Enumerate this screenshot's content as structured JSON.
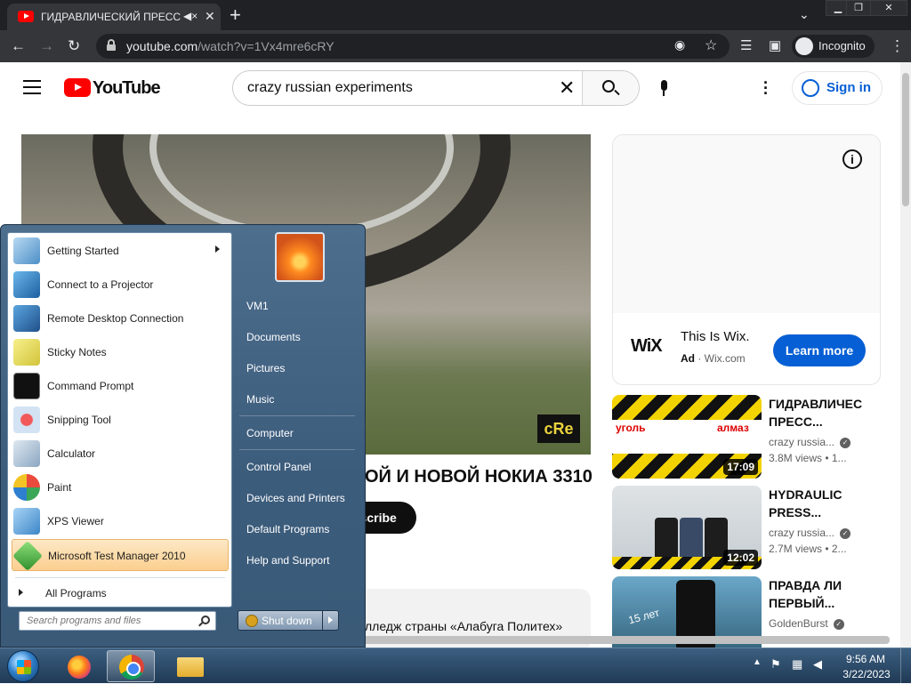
{
  "browser": {
    "tab_title": "ГИДРАВЛИЧЕСКИЙ ПРЕСС",
    "url_host": "youtube.com",
    "url_path": "/watch?v=1Vx4mre6cRY",
    "incognito_label": "Incognito"
  },
  "youtube": {
    "logo_text": "YouTube",
    "search_value": "crazy russian experiments",
    "signin_label": "Sign in",
    "video_title": "ОЙ И НОВОЙ НОКИА 3310",
    "subscribe_label": "bscribe",
    "watermark": "cRe",
    "description_text": "лледж страны «Алабуга Политех»",
    "ad": {
      "logo": "WiX",
      "title": "This Is Wix.",
      "badge": "Ad",
      "domain": "Wix.com",
      "cta": "Learn more"
    },
    "recommendations": [
      {
        "title": "ГИДРАВЛИЧЕС ПРЕСС...",
        "channel": "crazy russia...",
        "views": "3.8M views  •  1...",
        "duration": "17:09",
        "thumb_left": "уголь",
        "thumb_right": "алмаз"
      },
      {
        "title": "HYDRAULIC PRESS...",
        "channel": "crazy russia...",
        "views": "2.7M views  •  2...",
        "duration": "12:02"
      },
      {
        "title": "ПРАВДА ЛИ ПЕРВЫЙ...",
        "channel": "GoldenBurst",
        "views": "",
        "duration": "",
        "thumb_label": "15 лет"
      }
    ]
  },
  "start_menu": {
    "programs": [
      {
        "label": "Getting Started",
        "icon": "getting-started-icon",
        "submenu": true
      },
      {
        "label": "Connect to a Projector",
        "icon": "projector-icon"
      },
      {
        "label": "Remote Desktop Connection",
        "icon": "remote-desktop-icon"
      },
      {
        "label": "Sticky Notes",
        "icon": "sticky-notes-icon"
      },
      {
        "label": "Command Prompt",
        "icon": "command-prompt-icon"
      },
      {
        "label": "Snipping Tool",
        "icon": "snipping-tool-icon"
      },
      {
        "label": "Calculator",
        "icon": "calculator-icon"
      },
      {
        "label": "Paint",
        "icon": "paint-icon"
      },
      {
        "label": "XPS Viewer",
        "icon": "xps-viewer-icon"
      },
      {
        "label": "Microsoft Test Manager 2010",
        "icon": "test-manager-icon",
        "highlighted": true
      }
    ],
    "all_programs": "All Programs",
    "search_placeholder": "Search programs and files",
    "right_items": [
      "VM1",
      "Documents",
      "Pictures",
      "Music",
      "Computer",
      "Control Panel",
      "Devices and Printers",
      "Default Programs",
      "Help and Support"
    ],
    "shutdown_label": "Shut down"
  },
  "taskbar": {
    "time": "9:56 AM",
    "date": "3/22/2023"
  }
}
